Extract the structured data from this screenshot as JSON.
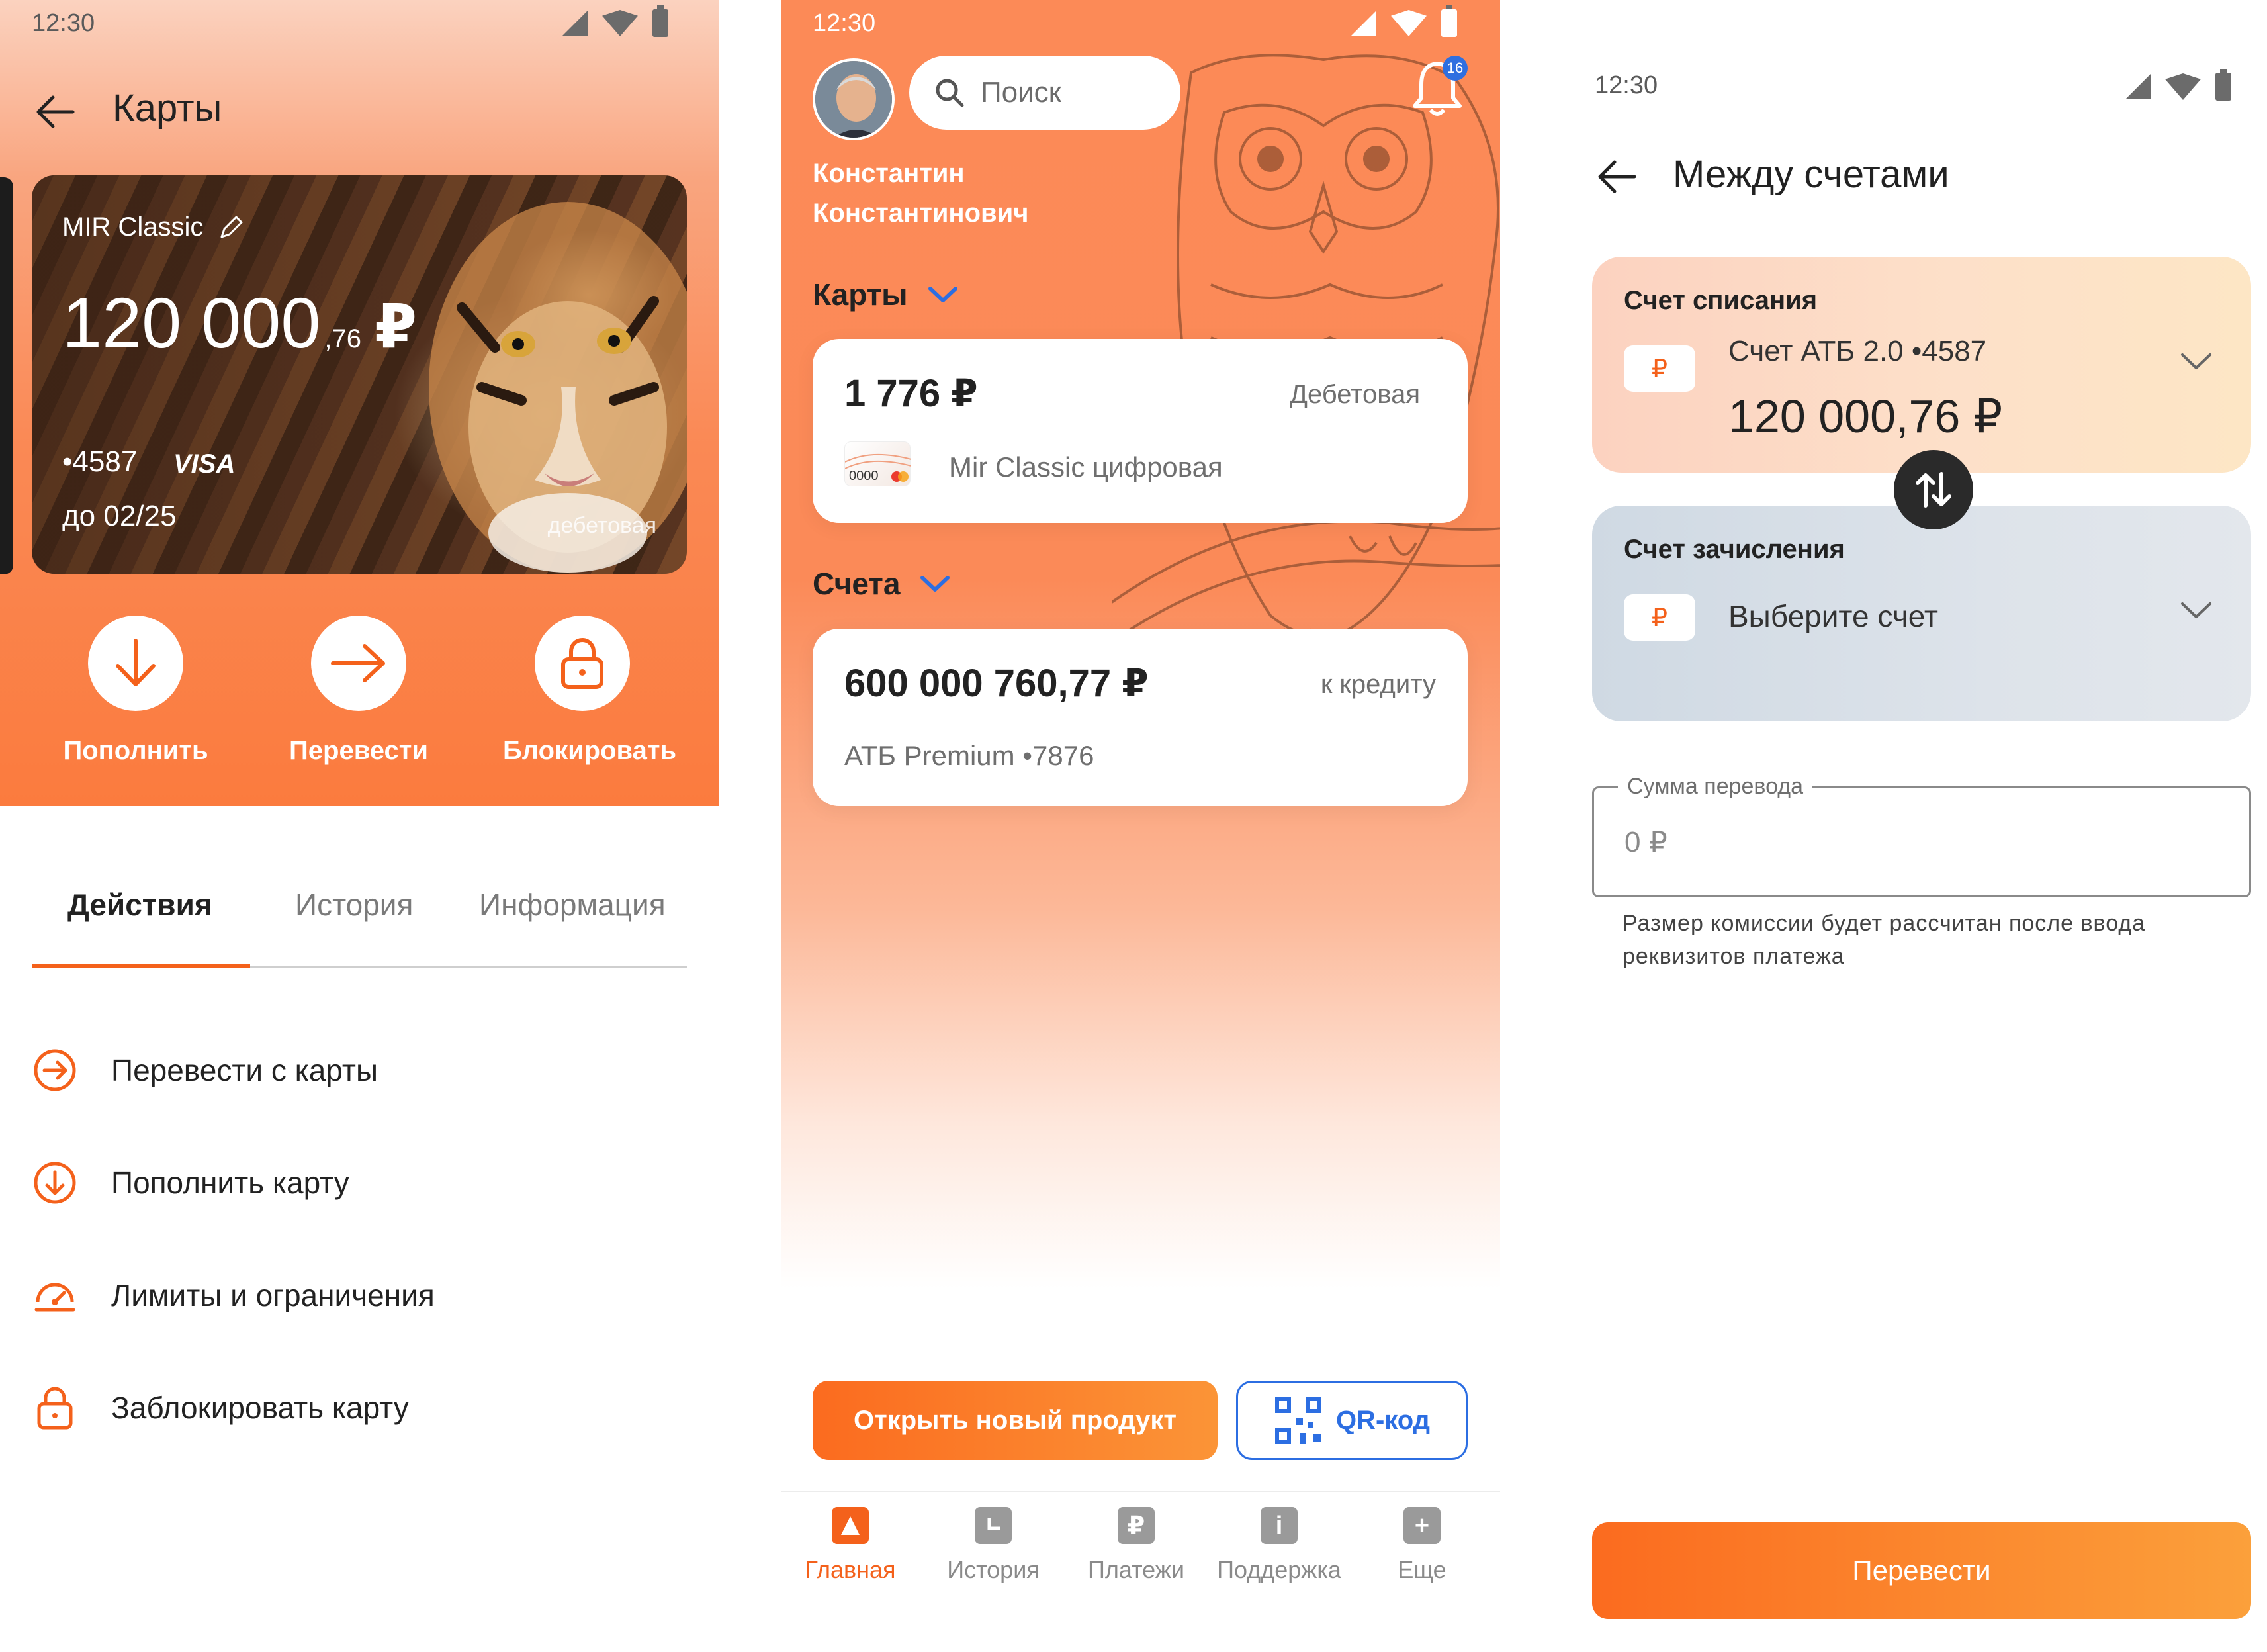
{
  "colors": {
    "accent": "#f4611b",
    "blue": "#2c6ee2",
    "dark": "#222222"
  },
  "screen1": {
    "time": "12:30",
    "title": "Карты",
    "card": {
      "name": "MIR Classic",
      "balance_main": "120 000",
      "balance_cents": ",76",
      "currency": "₽",
      "number": "•4587",
      "brand": "VISA",
      "expiry": "до 02/25",
      "type": "дебетовая"
    },
    "actions": [
      {
        "label": "Пополнить",
        "icon": "arrow-down-icon"
      },
      {
        "label": "Перевести",
        "icon": "arrow-right-icon"
      },
      {
        "label": "Блокировать",
        "icon": "lock-icon"
      }
    ],
    "tabs": [
      "Действия",
      "История",
      "Информация"
    ],
    "menu": [
      {
        "label": "Перевести с карты",
        "icon": "transfer-circle-icon"
      },
      {
        "label": "Пополнить карту",
        "icon": "topup-circle-icon"
      },
      {
        "label": "Лимиты и ограничения",
        "icon": "gauge-icon"
      },
      {
        "label": "Заблокировать карту",
        "icon": "lock-icon"
      }
    ]
  },
  "screen2": {
    "time": "12:30",
    "search_placeholder": "Поиск",
    "notifications": "16",
    "user_line1": "Константин",
    "user_line2": "Константинович",
    "cards_header": "Карты",
    "card_item": {
      "amount": "1 776 ₽",
      "type": "Дебетовая",
      "name": "Mir Classic цифровая",
      "mini_number": "0000"
    },
    "accounts_header": "Счета",
    "account_item": {
      "amount": "600 000 760,77 ₽",
      "type": "к кредиту",
      "name": "АТБ Premium •7876"
    },
    "open_button": "Открыть новый продукт",
    "qr_button": "QR-код",
    "nav": [
      {
        "label": "Главная",
        "icon": "home-icon",
        "active": true
      },
      {
        "label": "История",
        "icon": "clock-icon",
        "active": false
      },
      {
        "label": "Платежи",
        "icon": "ruble-icon",
        "active": false
      },
      {
        "label": "Поддержка",
        "icon": "info-icon",
        "active": false
      },
      {
        "label": "Еще",
        "icon": "plus-icon",
        "active": false
      }
    ]
  },
  "screen3": {
    "time": "12:30",
    "title": "Между счетами",
    "from": {
      "label": "Счет списания",
      "account": "Счет АТБ 2.0 •4587",
      "balance": "120 000,76 ₽",
      "currency_symbol": "₽"
    },
    "to": {
      "label": "Счет зачисления",
      "placeholder": "Выберите счет",
      "currency_symbol": "₽"
    },
    "amount_field": {
      "legend": "Сумма перевода",
      "value": "0 ₽"
    },
    "hint": "Размер комиссии будет рассчитан после ввода реквизитов платежа",
    "submit": "Перевести"
  }
}
